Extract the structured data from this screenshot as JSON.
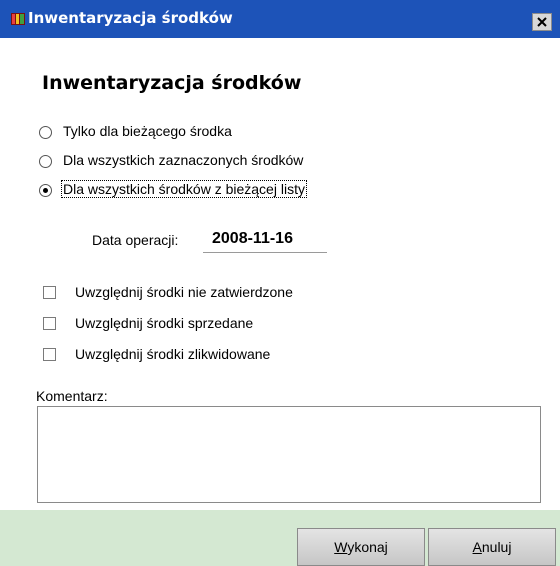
{
  "window": {
    "title": "Inwentaryzacja środków",
    "icon": "app-icon",
    "close_icon": "close-icon"
  },
  "heading": "Inwentaryzacja środków",
  "scope_options": [
    {
      "label": "Tylko dla bieżącego środka",
      "selected": false
    },
    {
      "label": "Dla wszystkich zaznaczonych środków",
      "selected": false
    },
    {
      "label": "Dla wszystkich środków z bieżącej listy",
      "selected": true
    }
  ],
  "operation_date": {
    "label": "Data operacji:",
    "value": "2008-11-16"
  },
  "filters": [
    {
      "label": "Uwzględnij środki nie zatwierdzone",
      "checked": false
    },
    {
      "label": "Uwzględnij środki sprzedane",
      "checked": false
    },
    {
      "label": "Uwzględnij środki zlikwidowane",
      "checked": false
    }
  ],
  "comment": {
    "label": "Komentarz:",
    "value": ""
  },
  "buttons": {
    "execute": {
      "hotkey": "W",
      "rest": "ykonaj"
    },
    "cancel": {
      "hotkey": "A",
      "rest": "nuluj"
    }
  },
  "colors": {
    "titlebar": "#1d53b8",
    "dialog_background": "#d4e8d2",
    "content_background": "#ffffff"
  }
}
